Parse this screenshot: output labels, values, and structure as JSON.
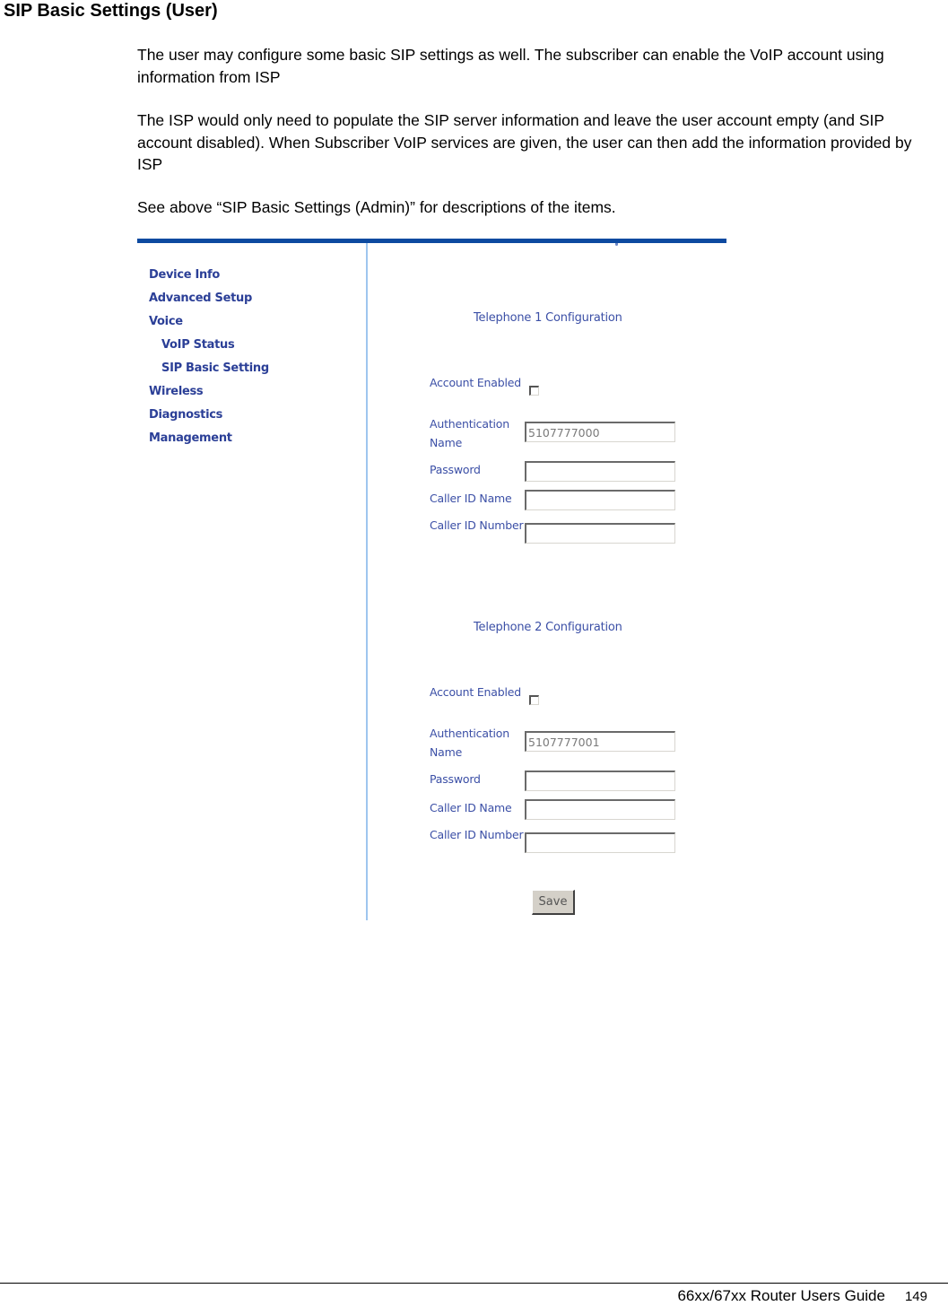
{
  "document": {
    "title": "SIP Basic Settings (User)",
    "paragraphs": [
      "The user may configure some basic SIP settings as well. The subscriber can enable the VoIP account using information from ISP",
      "The ISP would only need to populate the SIP server information and leave the user account empty (and SIP account disabled).  When Subscriber VoIP services are given, the user can then add the information provided by ISP",
      "See above “SIP Basic Settings (Admin)” for descriptions of the items."
    ]
  },
  "router_ui": {
    "accent_color": "#0d4aa0",
    "nav_color": "#2b3f97",
    "sidebar": {
      "items": [
        {
          "label": "Device Info",
          "level": 0
        },
        {
          "label": "Advanced Setup",
          "level": 0
        },
        {
          "label": "Voice",
          "level": 0
        },
        {
          "label": "VoIP Status",
          "level": 1
        },
        {
          "label": "SIP Basic Setting",
          "level": 1
        },
        {
          "label": "Wireless",
          "level": 0
        },
        {
          "label": "Diagnostics",
          "level": 0
        },
        {
          "label": "Management",
          "level": 0
        }
      ]
    },
    "telephones": [
      {
        "title": "Telephone 1 Configuration",
        "account_enabled_label": "Account Enabled",
        "account_enabled": false,
        "auth_name_label": "Authentication Name",
        "auth_name_value": "5107777000",
        "password_label": "Password",
        "password_value": "",
        "caller_id_name_label": "Caller ID Name",
        "caller_id_name_value": "",
        "caller_id_number_label": "Caller ID Number",
        "caller_id_number_value": ""
      },
      {
        "title": "Telephone 2 Configuration",
        "account_enabled_label": "Account Enabled",
        "account_enabled": false,
        "auth_name_label": "Authentication Name",
        "auth_name_value": "5107777001",
        "password_label": "Password",
        "password_value": "",
        "caller_id_name_label": "Caller ID Name",
        "caller_id_name_value": "",
        "caller_id_number_label": "Caller ID Number",
        "caller_id_number_value": ""
      }
    ],
    "save_label": "Save"
  },
  "footer": {
    "guide_title": "66xx/67xx Router Users Guide",
    "page_number": "149"
  }
}
